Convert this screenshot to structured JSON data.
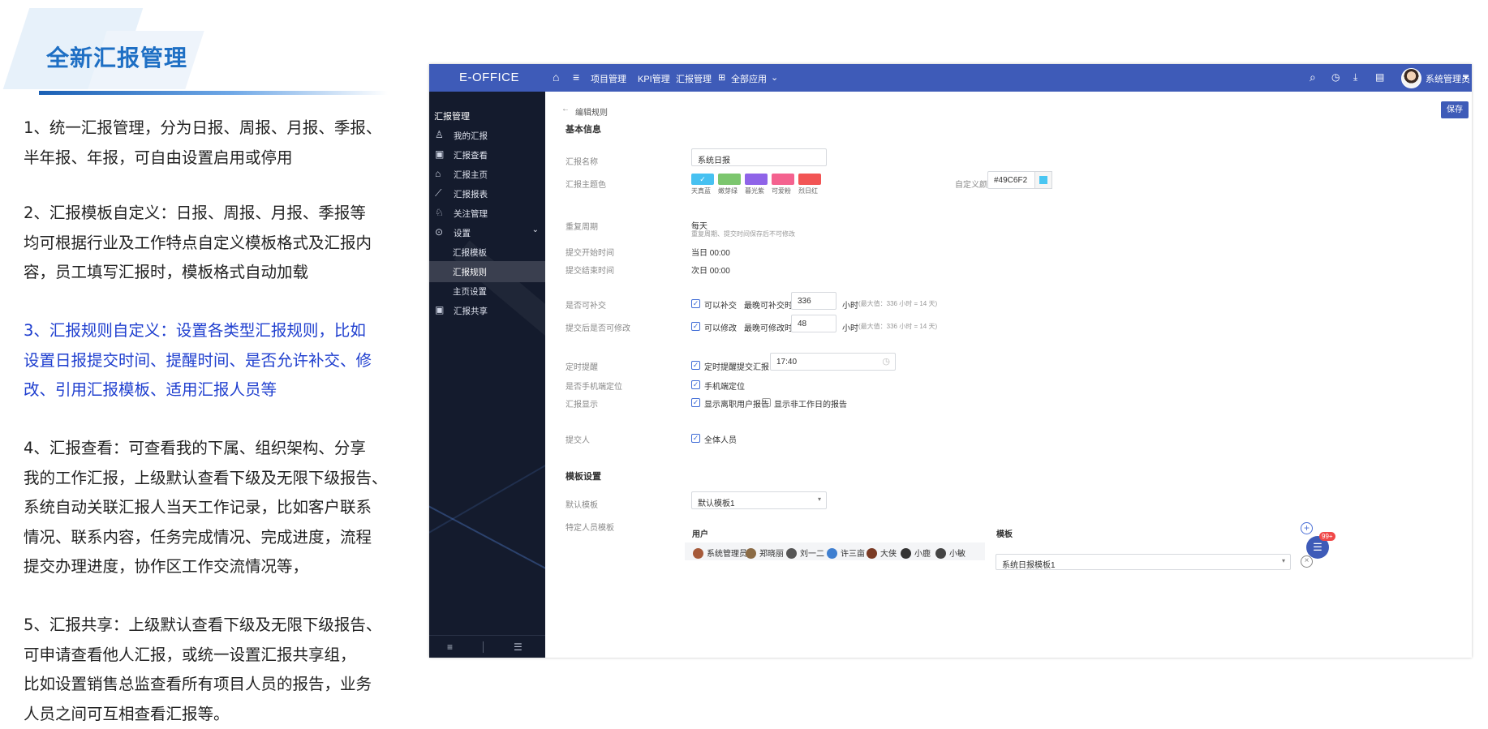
{
  "slide": {
    "title": "全新汇报管理",
    "paragraphs": [
      {
        "lines": [
          "1、统一汇报管理，分为日报、周报、月报、季报、",
          "半年报、年报，可自由设置启用或停用"
        ]
      },
      {
        "lines": [
          "2、汇报模板自定义：日报、周报、月报、季报等",
          "均可根据行业及工作特点自定义模板格式及汇报内",
          "容，员工填写汇报时，模板格式自动加载"
        ]
      },
      {
        "lines": [
          "3、汇报规则自定义：设置各类型汇报规则，比如",
          "设置日报提交时间、提醒时间、是否允许补交、修",
          "改、引用汇报模板、适用汇报人员等"
        ]
      },
      {
        "lines": [
          "4、汇报查看：可查看我的下属、组织架构、分享",
          "我的工作汇报，上级默认查看下级及无限下级报告、",
          "系统自动关联汇报人当天工作记录，比如客户联系",
          "情况、联系内容，任务完成情况、完成进度，流程",
          "提交办理进度，协作区工作交流情况等，"
        ]
      },
      {
        "lines": [
          "5、汇报共享：上级默认查看下级及无限下级报告、",
          "可申请查看他人汇报，或统一设置汇报共享组，",
          "比如设置销售总监查看所有项目人员的报告，业务",
          "人员之间可互相查看汇报等。"
        ]
      }
    ],
    "highlight_color": "#1f3fcf"
  },
  "app": {
    "brand": "E-OFFICE",
    "topnav": [
      "项目管理",
      "KPI管理",
      "汇报管理",
      "全部应用"
    ],
    "user_name": "系统管理员",
    "sidebar": {
      "header": "汇报管理",
      "items": [
        {
          "label": "我的汇报",
          "icon": "user-icon"
        },
        {
          "label": "汇报查看",
          "icon": "report-view-icon"
        },
        {
          "label": "汇报主页",
          "icon": "home-icon"
        },
        {
          "label": "汇报报表",
          "icon": "chart-icon"
        },
        {
          "label": "关注管理",
          "icon": "follow-icon"
        },
        {
          "label": "设置",
          "icon": "settings-icon"
        },
        {
          "label": "汇报模板",
          "icon": ""
        },
        {
          "label": "汇报规则",
          "icon": ""
        },
        {
          "label": "主页设置",
          "icon": ""
        },
        {
          "label": "汇报共享",
          "icon": "share-icon"
        }
      ]
    },
    "breadcrumb": "编辑规则",
    "save_label": "保存",
    "form": {
      "basic_section": "基本信息",
      "name_label": "汇报名称",
      "name_value": "系统日报",
      "theme_label": "汇报主题色",
      "theme_colors": [
        {
          "name": "天真蓝",
          "hex": "#47c1f1"
        },
        {
          "name": "嫩芽绿",
          "hex": "#7cc66e"
        },
        {
          "name": "暮光紫",
          "hex": "#8f64e8"
        },
        {
          "name": "可爱粉",
          "hex": "#f4628f"
        },
        {
          "name": "烈日红",
          "hex": "#f25454"
        }
      ],
      "custom_color_label": "自定义颜色",
      "custom_color_value": "#49C6F2",
      "cycle_label": "重复周期",
      "cycle_value": "每天",
      "cycle_hint": "重复周期、提交时间保存后不可修改",
      "start_label": "提交开始时间",
      "start_value": "当日 00:00",
      "end_label": "提交结束时间",
      "end_value": "次日 00:00",
      "makeup_label": "是否可补交",
      "makeup_check": "可以补交",
      "makeup_latest": "最晚可补交时间",
      "makeup_hours": "336",
      "hours_unit": "小时",
      "hours_hint": "(最大值：336 小时 = 14 天)",
      "modify_label": "提交后是否可修改",
      "modify_check": "可以修改",
      "modify_latest": "最晚可修改时间",
      "modify_hours": "48",
      "remind_label": "定时提醒",
      "remind_check": "定时提醒提交汇报",
      "remind_time": "17:40",
      "locate_label": "是否手机端定位",
      "locate_check": "手机端定位",
      "display_label": "汇报显示",
      "display_check1": "显示离职用户报告",
      "display_check2": "显示非工作日的报告",
      "submitter_label": "提交人",
      "submitter_check": "全体人员",
      "template_section": "模板设置",
      "default_tpl_label": "默认模板",
      "default_tpl_value": "默认模板1",
      "special_tpl_label": "特定人员模板",
      "col_user": "用户",
      "col_template": "模板",
      "users": [
        "系统管理员",
        "郑晓丽",
        "刘一二",
        "许三亩",
        "大侠",
        "小鹿",
        "小敏"
      ],
      "row_template": "系统日报模板1"
    },
    "chat_badge": "99+"
  }
}
